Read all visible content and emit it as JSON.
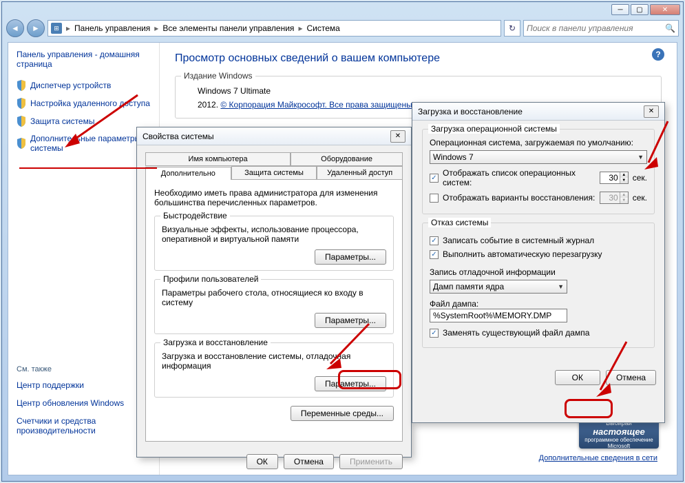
{
  "breadcrumb": {
    "item1": "Панель управления",
    "item2": "Все элементы панели управления",
    "item3": "Система"
  },
  "search": {
    "placeholder": "Поиск в панели управления"
  },
  "sidebar": {
    "home": "Панель управления - домашняя страница",
    "links": [
      "Диспетчер устройств",
      "Настройка удаленного доступа",
      "Защита системы",
      "Дополнительные параметры системы"
    ],
    "see_also": "См. также",
    "bottom_links": [
      "Центр поддержки",
      "Центр обновления Windows",
      "Счетчики и средства производительности"
    ]
  },
  "main": {
    "title": "Просмотр основных сведений о вашем компьютере",
    "edition_legend": "Издание Windows",
    "edition_name": "Windows 7 Ultimate",
    "copyright_pre": "2012. ",
    "copyright_link": "© Корпорация Майкрософт. Все права защищены.",
    "more_info": "Дополнительные сведения в сети"
  },
  "ms_badge": {
    "l1": "Выбирай",
    "l2": "настоящее",
    "l3": "программное обеспечение",
    "l4": "Microsoft"
  },
  "sysprops": {
    "title": "Свойства системы",
    "tabs_top": [
      "Имя компьютера",
      "Оборудование"
    ],
    "tabs_bottom": [
      "Дополнительно",
      "Защита системы",
      "Удаленный доступ"
    ],
    "desc": "Необходимо иметь права администратора для изменения большинства перечисленных параметров.",
    "g1": {
      "legend": "Быстродействие",
      "text": "Визуальные эффекты, использование процессора, оперативной и виртуальной памяти",
      "btn": "Параметры..."
    },
    "g2": {
      "legend": "Профили пользователей",
      "text": "Параметры рабочего стола, относящиеся ко входу в систему",
      "btn": "Параметры..."
    },
    "g3": {
      "legend": "Загрузка и восстановление",
      "text": "Загрузка и восстановление системы, отладочная информация",
      "btn": "Параметры..."
    },
    "env_btn": "Переменные среды...",
    "ok": "ОК",
    "cancel": "Отмена",
    "apply": "Применить"
  },
  "startup": {
    "title": "Загрузка и восстановление",
    "g1_legend": "Загрузка операционной системы",
    "default_os_label": "Операционная система, загружаемая по умолчанию:",
    "default_os_value": "Windows 7",
    "show_list": "Отображать список операционных систем:",
    "show_list_sec": "30",
    "show_recovery": "Отображать варианты восстановления:",
    "show_recovery_sec": "30",
    "sec_suffix": "сек.",
    "g2_legend": "Отказ системы",
    "log_event": "Записать событие в системный журнал",
    "auto_restart": "Выполнить автоматическую перезагрузку",
    "dump_label": "Запись отладочной информации",
    "dump_value": "Дамп памяти ядра",
    "dump_file_label": "Файл дампа:",
    "dump_file_value": "%SystemRoot%\\MEMORY.DMP",
    "overwrite": "Заменять существующий файл дампа",
    "ok": "ОК",
    "cancel": "Отмена"
  }
}
